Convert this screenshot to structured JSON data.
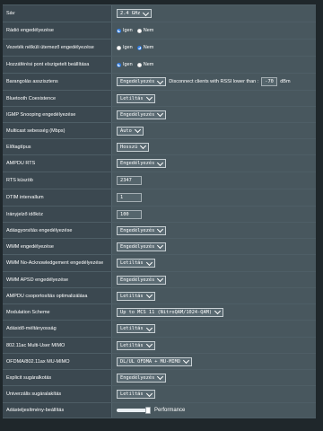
{
  "rows": [
    {
      "label": "Sáv",
      "type": "select",
      "value": "2.4 GHz"
    },
    {
      "label": "Rádió engedélyezése",
      "type": "radio",
      "options": [
        "Igen",
        "Nem"
      ],
      "selected": 0
    },
    {
      "label": "Vezeték nélküli ütemező engedélyezése",
      "type": "radio",
      "options": [
        "Igen",
        "Nem"
      ],
      "selected": 1
    },
    {
      "label": "Hozzáférési pont elszigetelt beállítása",
      "type": "radio",
      "options": [
        "Igen",
        "Nem"
      ],
      "selected": 0
    },
    {
      "label": "Barangolás asszisztens",
      "type": "roaming",
      "value": "Engedélyezés",
      "text": "Disconnect clients with RSSI lower than :",
      "input": "-70",
      "unit": "dBm"
    },
    {
      "label": "Bluetooth Coexistence",
      "type": "select",
      "value": "Letiltás"
    },
    {
      "label": "IGMP Snooping engedélyezése",
      "type": "select",
      "value": "Engedélyezés"
    },
    {
      "label": "Multicast sebesség (Mbps)",
      "type": "select",
      "value": "Auto"
    },
    {
      "label": "Előtagtípus",
      "type": "select",
      "value": "Hosszú"
    },
    {
      "label": "AMPDU RTS",
      "type": "select",
      "value": "Engedélyezés"
    },
    {
      "label": "RTS küszöb",
      "type": "input",
      "value": "2347"
    },
    {
      "label": "DTIM intervallum",
      "type": "input",
      "value": "1"
    },
    {
      "label": "Irányjelző időköz",
      "type": "input",
      "value": "100"
    },
    {
      "label": "Adásgyorsítás engedélyezése",
      "type": "select",
      "value": "Engedélyezés"
    },
    {
      "label": "WMM engedélyezése",
      "type": "select",
      "value": "Engedélyezés"
    },
    {
      "label": "WMM No-Acknowledgement engedélyezése",
      "type": "select",
      "value": "Letiltás"
    },
    {
      "label": "WMM APSD engedélyezése",
      "type": "select",
      "value": "Engedélyezés"
    },
    {
      "label": "AMPDU csoportosítás optimalizálása",
      "type": "select",
      "value": "Letiltás"
    },
    {
      "label": "Modulation Scheme",
      "type": "select",
      "value": "Up to MCS 11 (NitroQAM/1024-QAM)"
    },
    {
      "label": "Adásidő-méltányosság",
      "type": "select",
      "value": "Letiltás"
    },
    {
      "label": "802.11ac Multi-User MIMO",
      "type": "select",
      "value": "Letiltás"
    },
    {
      "label": "OFDMA/802.11ax MU-MIMO",
      "type": "select",
      "value": "DL/UL OFDMA + MU-MIMO"
    },
    {
      "label": "Explicit sugáralkotás",
      "type": "select",
      "value": "Engedélyezés"
    },
    {
      "label": "Univerzális sugáralakítás",
      "type": "select",
      "value": "Letiltás"
    },
    {
      "label": "Adásteljesítmény-beállítás",
      "type": "slider",
      "value": "Performance",
      "level": 1.0
    }
  ],
  "colors": {
    "radio_on": "#2d7ae0"
  }
}
